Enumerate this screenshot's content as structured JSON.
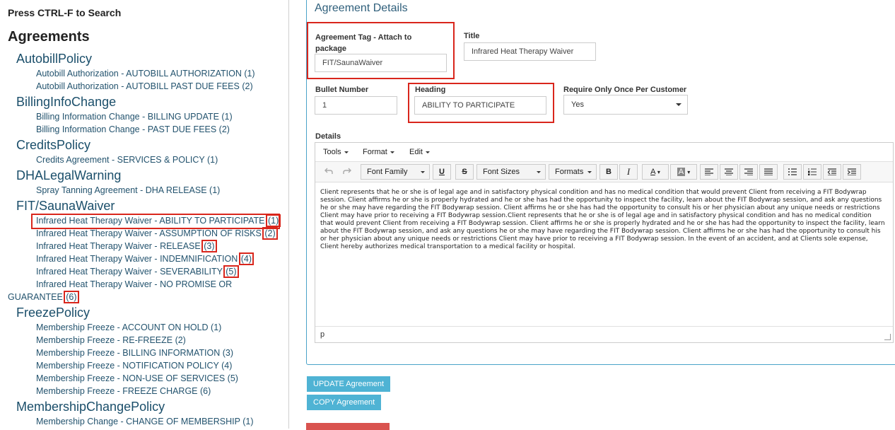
{
  "sidebar": {
    "hint": "Press CTRL-F to Search",
    "heading": "Agreements",
    "categories": [
      {
        "name": "AutobillPolicy",
        "items": [
          "Autobill Authorization - AUTOBILL AUTHORIZATION (1)",
          "Autobill Authorization - AUTOBILL PAST DUE FEES (2)"
        ]
      },
      {
        "name": "BillingInfoChange",
        "items": [
          "Billing Information Change - BILLING UPDATE (1)",
          "Billing Information Change - PAST DUE FEES (2)"
        ]
      },
      {
        "name": "CreditsPolicy",
        "items": [
          "Credits Agreement - SERVICES & POLICY (1)"
        ]
      },
      {
        "name": "DHALegalWarning",
        "items": [
          "Spray Tanning Agreement - DHA RELEASE (1)"
        ]
      },
      {
        "name": "FIT/SaunaWaiver",
        "items": [
          {
            "text": "Infrared Heat Therapy Waiver - ABILITY TO PARTICIPATE ",
            "num": "(1)"
          },
          {
            "text": "Infrared Heat Therapy Waiver - ASSUMPTION OF RISKS ",
            "num": "(2)"
          },
          {
            "text": "Infrared Heat Therapy Waiver - RELEASE ",
            "num": "(3)"
          },
          {
            "text": "Infrared Heat Therapy Waiver - INDEMNIFICATION ",
            "num": "(4)"
          },
          {
            "text": "Infrared Heat Therapy Waiver - SEVERABILITY ",
            "num": "(5)"
          },
          {
            "text": "Infrared Heat Therapy Waiver - NO PROMISE OR",
            "text2": "GUARANTEE ",
            "num": "(6)"
          }
        ]
      },
      {
        "name": "FreezePolicy",
        "items": [
          "Membership Freeze - ACCOUNT ON HOLD (1)",
          "Membership Freeze - RE-FREEZE (2)",
          "Membership Freeze - BILLING INFORMATION (3)",
          "Membership Freeze - NOTIFICATION POLICY (4)",
          "Membership Freeze - NON-USE OF SERVICES (5)",
          "Membership Freeze - FREEZE CHARGE (6)"
        ]
      },
      {
        "name": "MembershipChangePolicy",
        "items": [
          "Membership Change - CHANGE OF MEMBERSHIP (1)"
        ]
      }
    ]
  },
  "details": {
    "title": "Agreement Details",
    "tag_label": "Agreement Tag - Attach to package",
    "tag_value": "FIT/SaunaWaiver",
    "title_label": "Title",
    "title_value": "Infrared Heat Therapy Waiver",
    "bullet_label": "Bullet Number",
    "bullet_value": "1",
    "heading_label": "Heading",
    "heading_value": "ABILITY TO PARTICIPATE",
    "require_label": "Require Only Once Per Customer",
    "require_value": "Yes",
    "details_label": "Details"
  },
  "editor": {
    "menus": [
      "Tools",
      "Format",
      "Edit"
    ],
    "font_family": "Font Family",
    "font_sizes": "Font Sizes",
    "formats": "Formats",
    "content": "Client represents that he or she is of legal age and in satisfactory physical condition and has no medical condition that would prevent Client from receiving a FIT Bodywrap session. Client affirms he or she is properly hydrated and he or she has had the opportunity to inspect the facility, learn about the FIT Bodywrap session, and ask any questions he or she may have regarding the FIT Bodywrap session. Client affirms he or she has had the opportunity to consult his or her physician about any unique needs or restrictions Client may have prior to receiving a FIT Bodywrap session.Client represents that he or she is of legal age and in satisfactory physical condition and has no medical condition that would prevent Client from receiving a FIT Bodywrap session. Client affirms he or she is properly hydrated and he or she has had the opportunity to inspect the facility, learn about the FIT Bodywrap session, and ask any questions he or she may have regarding the FIT Bodywrap session. Client affirms he or she has had the opportunity to consult his or her physician about any unique needs or restrictions Client may have prior to receiving a FIT Bodywrap session. In the event of an accident, and at Clients sole expense, Client hereby authorizes medical transportation to a medical facility or hospital.",
    "status_path": "p"
  },
  "buttons": {
    "update": "UPDATE Agreement",
    "copy": "COPY Agreement"
  },
  "colors": {
    "accent": "#4fb3d4",
    "highlight": "#d9261c",
    "link": "#23536e"
  }
}
